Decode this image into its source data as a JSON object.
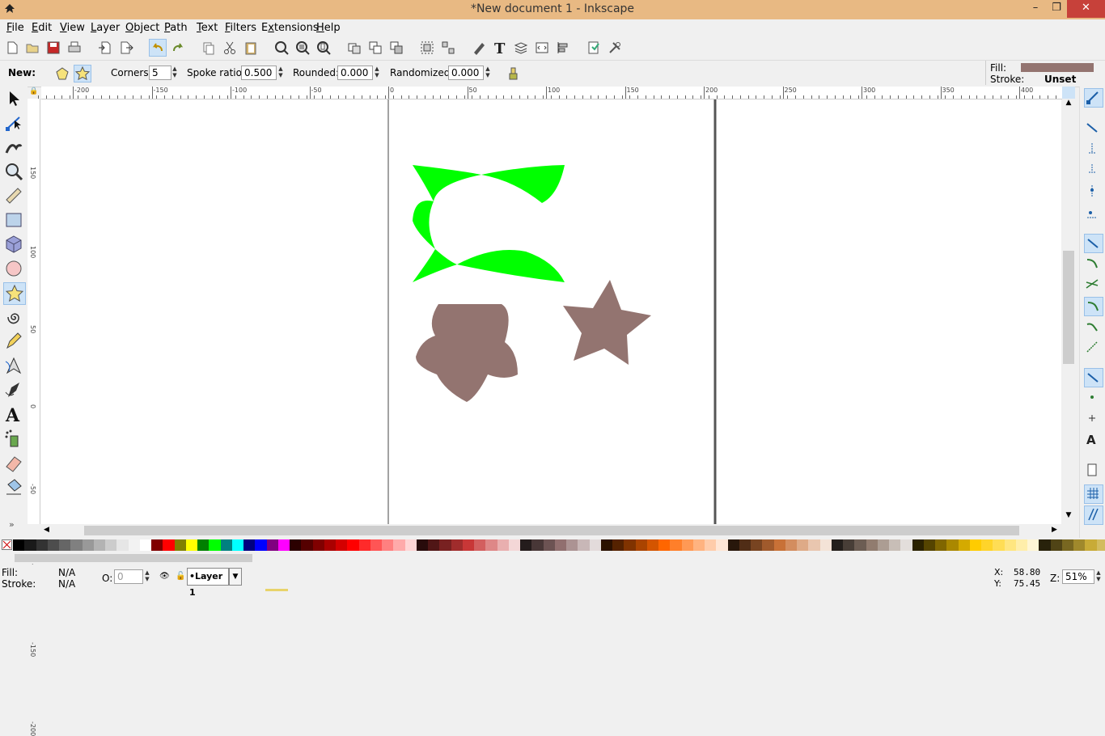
{
  "window": {
    "title": "*New document 1 - Inkscape",
    "min": "–",
    "max": "❐",
    "close": "✕"
  },
  "menu": [
    "File",
    "Edit",
    "View",
    "Layer",
    "Object",
    "Path",
    "Text",
    "Filters",
    "Extensions",
    "Help"
  ],
  "menu_underline": [
    "F",
    "E",
    "V",
    "L",
    "O",
    "P",
    "T",
    "F",
    "x",
    "H"
  ],
  "controls": {
    "new_label": "New:",
    "corners_label": "Corners:",
    "corners_value": "5",
    "spoke_label": "Spoke ratio:",
    "spoke_value": "0.500",
    "rounded_label": "Rounded:",
    "rounded_value": "0.000",
    "randomized_label": "Randomized:",
    "randomized_value": "0.000"
  },
  "style_indicator": {
    "fill_label": "Fill:",
    "stroke_label": "Stroke:",
    "stroke_value": "Unset",
    "fill_color": "#937470"
  },
  "ruler_h": [
    "-200",
    "-150",
    "-100",
    "-50",
    "0",
    "50",
    "100",
    "150",
    "200",
    "250",
    "300",
    "350",
    "400"
  ],
  "ruler_v": [
    "150",
    "100",
    "50",
    "0",
    "-50",
    "-100",
    "-150",
    "-200"
  ],
  "shapes": {
    "green": "#00ff00",
    "brown": "#937470"
  },
  "palette": [
    "#000000",
    "#1a1a1a",
    "#333333",
    "#4d4d4d",
    "#666666",
    "#808080",
    "#999999",
    "#b3b3b3",
    "#cccccc",
    "#e6e6e6",
    "#f2f2f2",
    "#ffffff",
    "#800000",
    "#ff0000",
    "#808000",
    "#ffff00",
    "#008000",
    "#00ff00",
    "#008080",
    "#00ffff",
    "#000080",
    "#0000ff",
    "#800080",
    "#ff00ff",
    "#2b0000",
    "#550000",
    "#800000",
    "#aa0000",
    "#d40000",
    "#ff0000",
    "#ff2a2a",
    "#ff5555",
    "#ff8080",
    "#ffaaaa",
    "#ffd5d5",
    "#280b0b",
    "#501616",
    "#782121",
    "#a02c2c",
    "#c83737",
    "#d35f5f",
    "#de8787",
    "#e9afaf",
    "#f4d7d7",
    "#241c1c",
    "#483737",
    "#6c5353",
    "#916f6f",
    "#ac9393",
    "#c8b7b7",
    "#e3dbdb",
    "#2b1100",
    "#552200",
    "#803300",
    "#aa4400",
    "#d45500",
    "#ff6600",
    "#ff7f2a",
    "#ff9955",
    "#ffb380",
    "#ffccaa",
    "#ffe6d5",
    "#28170b",
    "#502d16",
    "#784421",
    "#a05a2c",
    "#c87137",
    "#d38d5f",
    "#deaa87",
    "#e9c6af",
    "#f4e3d7",
    "#241f1c",
    "#483e37",
    "#6c5d53",
    "#917c6f",
    "#ac9d93",
    "#c8beb7",
    "#e3dedb",
    "#2b2200",
    "#554400",
    "#806600",
    "#aa8800",
    "#d4aa00",
    "#ffcc00",
    "#ffd42a",
    "#ffdd55",
    "#ffe680",
    "#ffeeaa",
    "#fff6d5",
    "#28220b",
    "#504416",
    "#786721",
    "#a0892c",
    "#c8ab37",
    "#d3bc5f"
  ],
  "status": {
    "fill_label": "Fill:",
    "fill_value": "N/A",
    "stroke_label": "Stroke:",
    "stroke_value": "N/A",
    "opacity_label": "O:",
    "opacity_value": "0",
    "layer_name": "•Layer 1",
    "x_label": "X:",
    "x_value": "58.80",
    "y_label": "Y:",
    "y_value": "75.45",
    "zoom_label": "Z:",
    "zoom_value": "51%"
  }
}
